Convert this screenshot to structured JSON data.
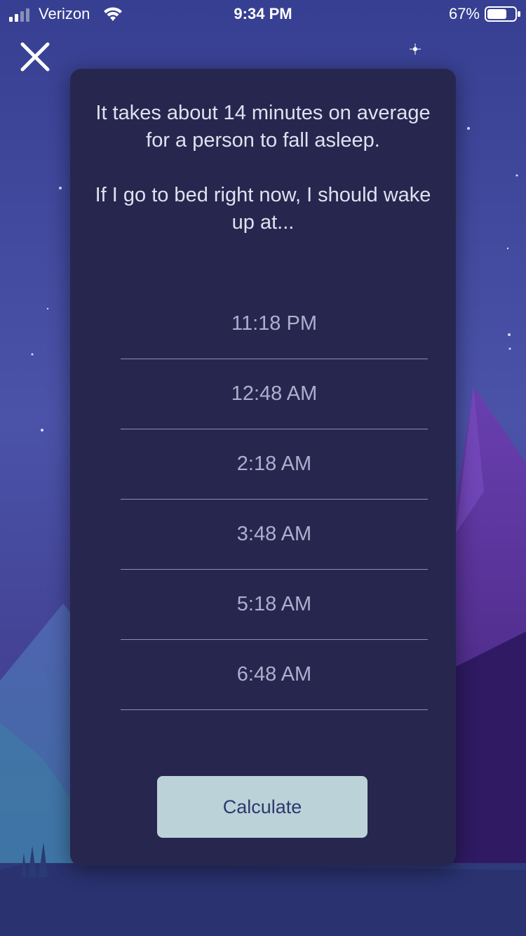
{
  "status_bar": {
    "carrier": "Verizon",
    "time": "9:34 PM",
    "battery_percent": "67%"
  },
  "close_button": {
    "icon": "close-icon"
  },
  "card": {
    "intro_line1": "It takes about 14 minutes on average for a person to fall asleep.",
    "intro_line2": "If I go to bed right now, I should wake up at...",
    "wake_times": [
      "11:18 PM",
      "12:48 AM",
      "2:18 AM",
      "3:48 AM",
      "5:18 AM",
      "6:48 AM"
    ],
    "calculate_label": "Calculate"
  },
  "colors": {
    "card_background": "#27264f",
    "button_background": "#bcd2d9",
    "button_text": "#2b3a6e",
    "time_text": "#aab0ce"
  }
}
